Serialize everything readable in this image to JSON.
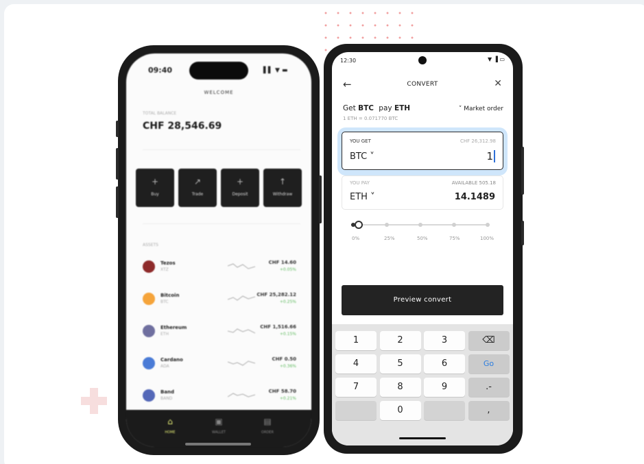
{
  "left_phone": {
    "time": "09:40",
    "status": "▌▌ ▼ ▬",
    "welcome": "WELCOME",
    "balance_label": "TOTAL BALANCE",
    "balance": "CHF 28,546.69",
    "actions": [
      {
        "label": "Buy",
        "glyph": "+",
        "icon": "plus-icon"
      },
      {
        "label": "Trade",
        "glyph": "↗",
        "icon": "trade-icon"
      },
      {
        "label": "Deposit",
        "glyph": "+",
        "icon": "deposit-icon"
      },
      {
        "label": "Withdraw",
        "glyph": "↑",
        "icon": "withdraw-icon"
      }
    ],
    "section_label": "ASSETS",
    "coins": [
      {
        "name": "Tezos",
        "symbol": "XTZ",
        "price": "CHF 14.60",
        "change": "+0.05%",
        "color": "#8e2b2b"
      },
      {
        "name": "Bitcoin",
        "symbol": "BTC",
        "price": "CHF 25,282.12",
        "change": "+0.25%",
        "color": "#f5a43b"
      },
      {
        "name": "Ethereum",
        "symbol": "ETH",
        "price": "CHF 1,516.66",
        "change": "+0.15%",
        "color": "#6f6f9f"
      },
      {
        "name": "Cardano",
        "symbol": "ADA",
        "price": "CHF 0.50",
        "change": "+0.36%",
        "color": "#4a7bd6"
      },
      {
        "name": "Band",
        "symbol": "BAND",
        "price": "CHF 58.70",
        "change": "+0.21%",
        "color": "#5468b8"
      }
    ],
    "nav": [
      {
        "label": "HOME",
        "glyph": "⌂",
        "icon": "home-icon"
      },
      {
        "label": "WALLET",
        "glyph": "▣",
        "icon": "wallet-icon"
      },
      {
        "label": "ORDER",
        "glyph": "▤",
        "icon": "order-icon"
      }
    ]
  },
  "right_phone": {
    "time": "12:30",
    "status": "▼ ▐ ▭",
    "header": {
      "back_glyph": "←",
      "title": "CONVERT",
      "close_glyph": "✕"
    },
    "pair": {
      "get_word": "Get",
      "get_asset": "BTC",
      "pay_word": "pay",
      "pay_asset": "ETH"
    },
    "rate": "1 ETH = 0.071770 BTC",
    "order_type": "˅ Market order",
    "you_get": {
      "label": "YOU GET",
      "fiat": "CHF 26,312.98",
      "currency": "BTC ˅",
      "value": "1"
    },
    "you_pay": {
      "label": "YOU PAY",
      "available": "AVAILABLE  505.18",
      "currency": "ETH ˅",
      "value": "14.1489"
    },
    "slider": {
      "value_percent": 3,
      "marks": [
        "0%",
        "25%",
        "50%",
        "75%",
        "100%"
      ]
    },
    "preview_button": "Preview convert",
    "keypad": [
      "1",
      "2",
      "3",
      "⌫",
      "4",
      "5",
      "6",
      "Go",
      "7",
      "8",
      "9",
      ".-",
      "",
      "0",
      "",
      ","
    ]
  },
  "colors": {
    "accent_blue": "#2b7de0",
    "highlight": "#cfe6fb",
    "dark": "#232323",
    "nav_active": "#e9f277"
  }
}
